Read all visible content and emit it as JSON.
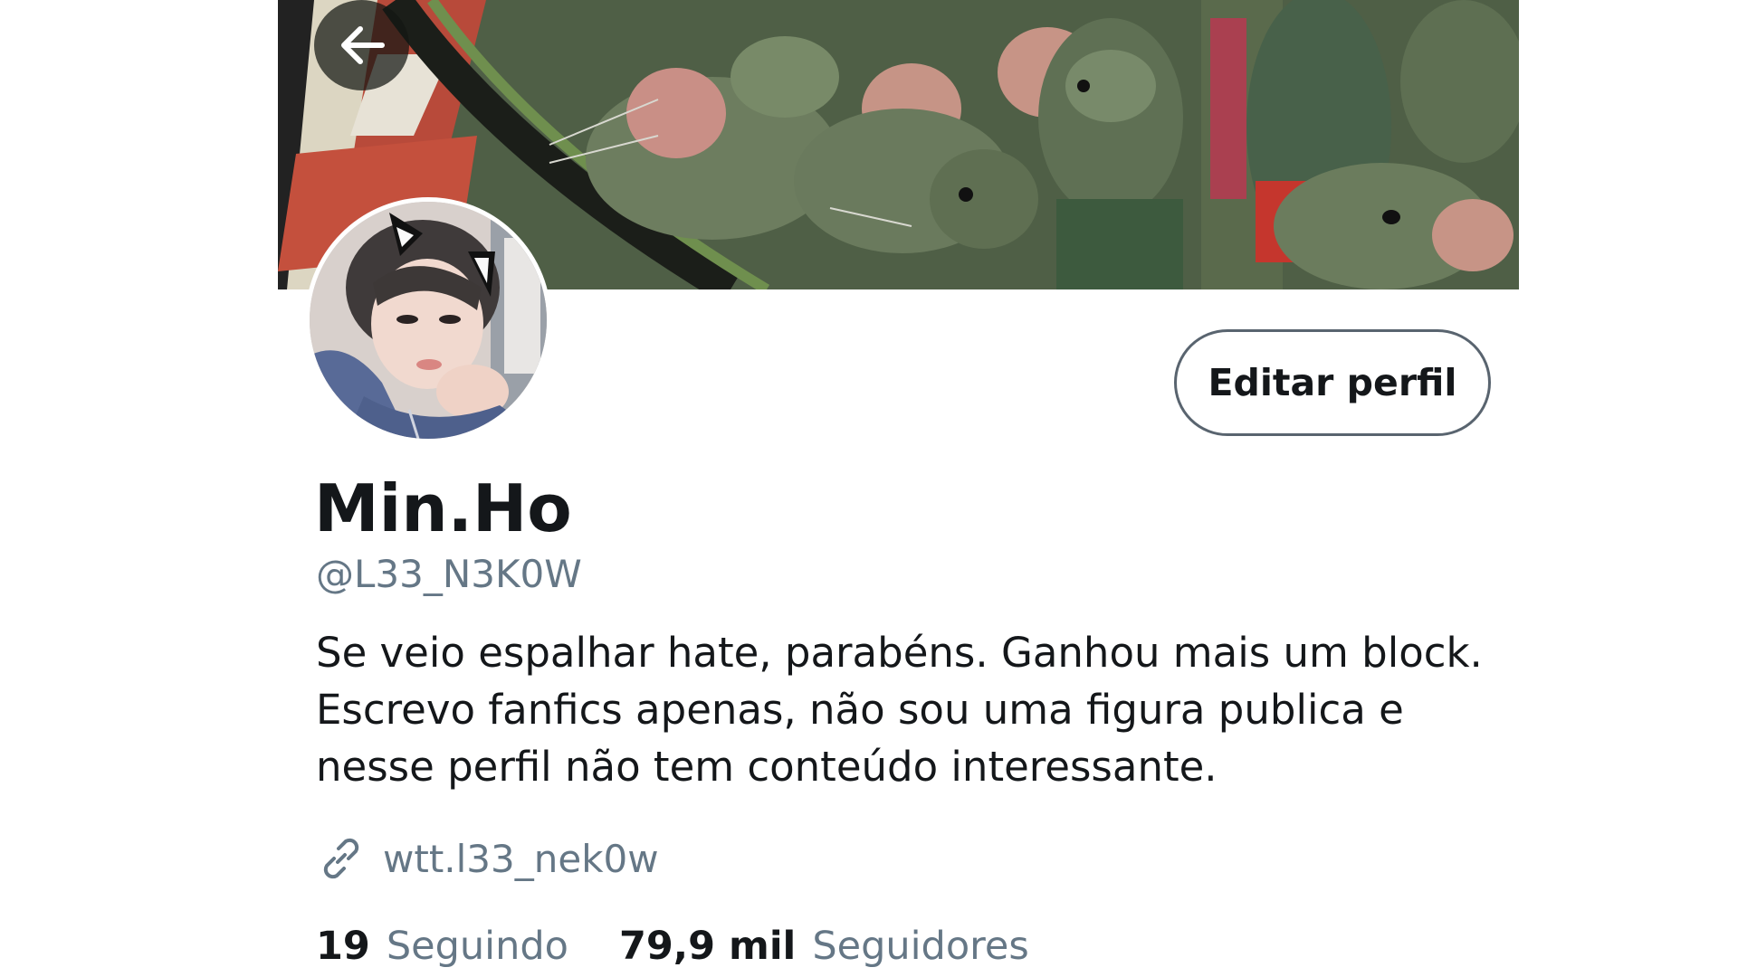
{
  "profile": {
    "display_name": "Min.Ho",
    "handle": "@L33_N3K0W",
    "bio": "Se veio espalhar hate, parabéns. Ganhou mais um block. Escrevo fanfics apenas, não sou uma figura publica e nesse perfil não tem conteúdo interessante.",
    "link": "wtt.l33_nek0w",
    "edit_button_label": "Editar perfil"
  },
  "stats": {
    "following_count": "19",
    "following_label": "Seguindo",
    "followers_count": "79,9 mil",
    "followers_label": "Seguidores"
  },
  "icons": {
    "back": "arrow-left-icon",
    "link": "link-icon"
  },
  "colors": {
    "text_primary": "#14171a",
    "text_secondary": "#657786",
    "button_border": "#59646f",
    "background": "#ffffff"
  }
}
